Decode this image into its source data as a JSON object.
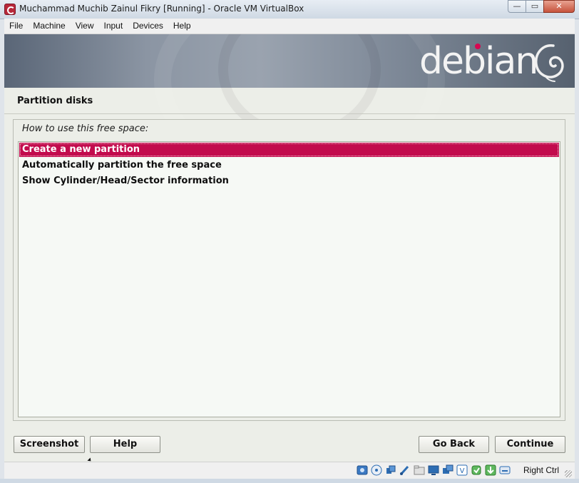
{
  "window": {
    "title": "Muchammad Muchib Zainul Fikry [Running] - Oracle VM VirtualBox",
    "controls": {
      "minimize": "—",
      "restore": "▭",
      "close": "✕"
    }
  },
  "menubar": {
    "items": [
      {
        "label": "File"
      },
      {
        "label": "Machine"
      },
      {
        "label": "View"
      },
      {
        "label": "Input"
      },
      {
        "label": "Devices"
      },
      {
        "label": "Help"
      }
    ]
  },
  "guest": {
    "logo_text": "debian",
    "page_title": "Partition disks",
    "question": "How to use this free space:",
    "options": [
      {
        "label": "Create a new partition",
        "selected": true
      },
      {
        "label": "Automatically partition the free space",
        "selected": false
      },
      {
        "label": "Show Cylinder/Head/Sector information",
        "selected": false
      }
    ],
    "buttons": {
      "screenshot": "Screenshot",
      "help": "Help",
      "go_back": "Go Back",
      "continue": "Continue"
    }
  },
  "statusbar": {
    "icons": [
      "hard-disk-icon",
      "optical-drive-icon",
      "audio-icon",
      "usb-icon",
      "shared-folders-icon",
      "display-icon",
      "network-icon",
      "video-capture-icon",
      "cpu-icon",
      "mouse-integration-icon",
      "keyboard-capture-icon"
    ],
    "host_key": "Right Ctrl"
  },
  "colors": {
    "selection": "#c20b4d",
    "debian_red": "#d70751",
    "list_background": "#f6f9f5"
  }
}
